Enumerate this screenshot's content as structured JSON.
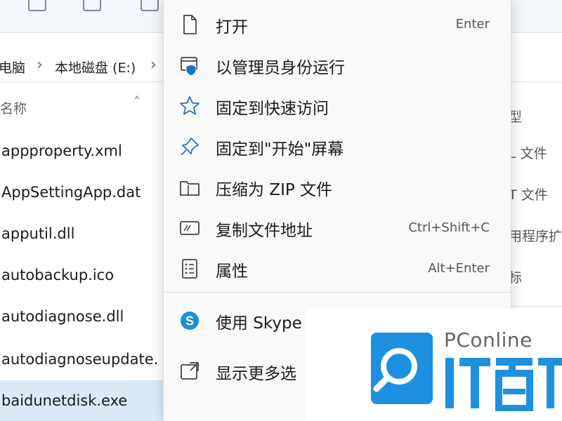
{
  "explorer": {
    "breadcrumb": [
      "电脑",
      "本地磁盘 (E:)"
    ],
    "column_name": "名称",
    "files": [
      "appproperty.xml",
      "AppSettingApp.dat",
      "apputil.dll",
      "autobackup.ico",
      "autodiagnose.dll",
      "autodiagnoseupdate.",
      "baidunetdisk.exe"
    ],
    "selected_file_index": 6,
    "type_header": "型",
    "types": [
      "L 文件",
      "T 文件",
      "用程序扩",
      "标"
    ]
  },
  "context_menu": {
    "items": [
      {
        "icon": "file-icon",
        "label": "打开",
        "shortcut": "Enter"
      },
      {
        "icon": "admin-shield-icon",
        "label": "以管理员身份运行",
        "shortcut": ""
      },
      {
        "icon": "star-icon",
        "label": "固定到快速访问",
        "shortcut": ""
      },
      {
        "icon": "pin-icon",
        "label": "固定到\"开始\"屏幕",
        "shortcut": ""
      },
      {
        "icon": "zip-folder-icon",
        "label": "压缩为 ZIP 文件",
        "shortcut": ""
      },
      {
        "icon": "copy-path-icon",
        "label": "复制文件地址",
        "shortcut": "Ctrl+Shift+C"
      },
      {
        "icon": "properties-icon",
        "label": "属性",
        "shortcut": "Alt+Enter"
      },
      {
        "icon": "skype-icon",
        "label": "使用 Skype 共",
        "shortcut": ""
      },
      {
        "icon": "more-options-icon",
        "label": "显示更多选",
        "shortcut": ""
      }
    ]
  },
  "watermark": {
    "brand": "PConline",
    "accent_color": "#1e90e0"
  }
}
